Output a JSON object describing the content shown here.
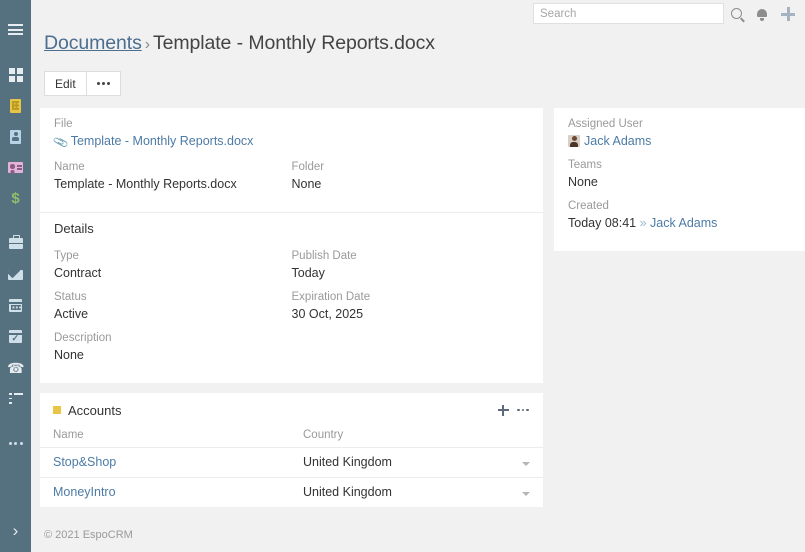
{
  "sidebar": {
    "items": [
      {
        "name": "menu-toggle",
        "icon": "hamburger-icon"
      },
      {
        "name": "dashboard",
        "icon": "grid-icon"
      },
      {
        "name": "accounts",
        "icon": "building-icon"
      },
      {
        "name": "contacts",
        "icon": "id-card-icon"
      },
      {
        "name": "leads",
        "icon": "contact-card-icon"
      },
      {
        "name": "opportunities",
        "icon": "dollar-icon"
      },
      {
        "name": "cases",
        "icon": "briefcase-icon"
      },
      {
        "name": "emails",
        "icon": "envelope-icon"
      },
      {
        "name": "calendar",
        "icon": "calendar-icon"
      },
      {
        "name": "tasks",
        "icon": "calendar-check-icon"
      },
      {
        "name": "calls",
        "icon": "phone-icon"
      },
      {
        "name": "stream",
        "icon": "list-icon"
      },
      {
        "name": "more",
        "icon": "ellipsis-icon"
      }
    ],
    "expand_icon": "chevron-right-icon"
  },
  "topbar": {
    "search_placeholder": "Search",
    "search_value": "",
    "search_icon": "magnifier-icon",
    "bell_icon": "bell-icon",
    "plus_icon": "plus-icon"
  },
  "header": {
    "breadcrumb_link": "Documents",
    "breadcrumb_separator": "›",
    "record_title": "Template - Monthly Reports.docx"
  },
  "toolbar": {
    "edit_label": "Edit",
    "more_icon": "ellipsis-icon"
  },
  "record": {
    "file": {
      "label": "File",
      "attachment_icon": "paperclip-icon",
      "value": "Template - Monthly Reports.docx"
    },
    "name": {
      "label": "Name",
      "value": "Template - Monthly Reports.docx"
    },
    "folder": {
      "label": "Folder",
      "value": "None"
    },
    "details_title": "Details",
    "type": {
      "label": "Type",
      "value": "Contract"
    },
    "publish_date": {
      "label": "Publish Date",
      "value": "Today"
    },
    "status": {
      "label": "Status",
      "value": "Active"
    },
    "expiration_date": {
      "label": "Expiration Date",
      "value": "30 Oct, 2025"
    },
    "description": {
      "label": "Description",
      "value": "None"
    }
  },
  "side_panel": {
    "assigned_user": {
      "label": "Assigned User",
      "value": "Jack Adams",
      "avatar_icon": "avatar-icon"
    },
    "teams": {
      "label": "Teams",
      "value": "None"
    },
    "created": {
      "label": "Created",
      "value": "Today 08:41",
      "separator": "»",
      "by": "Jack Adams"
    }
  },
  "accounts_panel": {
    "title": "Accounts",
    "marker_color": "#e8c547",
    "add_icon": "plus-icon",
    "menu_icon": "ellipsis-icon",
    "columns": [
      "Name",
      "Country"
    ],
    "rows": [
      {
        "name": "Stop&Shop",
        "country": "United Kingdom",
        "caret_icon": "caret-down-icon"
      },
      {
        "name": "MoneyIntro",
        "country": "United Kingdom",
        "caret_icon": "caret-down-icon"
      }
    ]
  },
  "footer": {
    "text": "© 2021 EspoCRM"
  }
}
